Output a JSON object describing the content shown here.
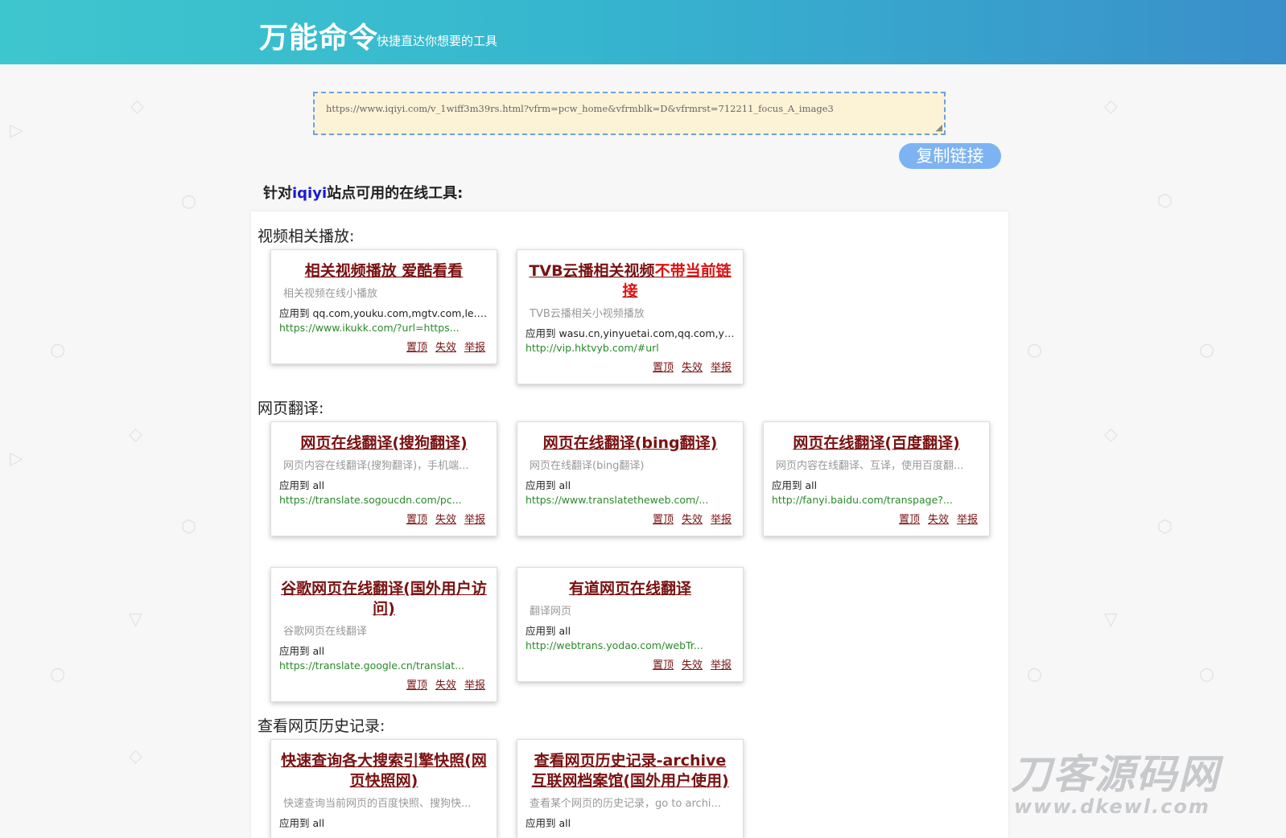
{
  "header": {
    "brand": "万能命令",
    "tagline": "快捷直达你想要的工具"
  },
  "url_box": {
    "value": "https://www.iqiyi.com/v_1wiff3m39rs.html?vfrm=pcw_home&vfrmblk=D&vfrmrst=712211_focus_A_image3"
  },
  "copy_button": {
    "label": "复制链接"
  },
  "site_heading": {
    "prefix": "针对",
    "site": "iqiyi",
    "suffix": "站点可用的在线工具:"
  },
  "sections": [
    {
      "title": "视频相关播放:",
      "cards": [
        {
          "title": "相关视频播放 爱酷看看",
          "desc": "相关视频在线小播放",
          "apply": "应用到 qq.com,youku.com,mgtv.com,le.com,...",
          "url": "https://www.ikukk.com/?url=https..."
        },
        {
          "title": "TVB云播相关视频",
          "title_warn": "不带当前链接",
          "desc": "TVB云播相关小视频播放",
          "apply": "应用到 wasu.cn,yinyuetai.com,qq.com,youku....",
          "url": "http://vip.hktvyb.com/#url"
        }
      ]
    },
    {
      "title": "网页翻译:",
      "cards": [
        {
          "title": "网页在线翻译(搜狗翻译)",
          "desc": "网页内容在线翻译(搜狗翻译)，手机端...",
          "apply": "应用到 all",
          "url": "https://translate.sogoucdn.com/pc..."
        },
        {
          "title": "网页在线翻译(bing翻译)",
          "desc": "网页在线翻译(bing翻译)",
          "apply": "应用到 all",
          "url": "https://www.translatetheweb.com/..."
        },
        {
          "title": "网页在线翻译(百度翻译)",
          "desc": "网页内容在线翻译、互译，使用百度翻...",
          "apply": "应用到 all",
          "url": "http://fanyi.baidu.com/transpage?..."
        },
        {
          "title": "谷歌网页在线翻译(国外用户访问)",
          "desc": "谷歌网页在线翻译",
          "apply": "应用到 all",
          "url": "https://translate.google.cn/translat..."
        },
        {
          "title": "有道网页在线翻译",
          "desc": "翻译网页",
          "apply": "应用到 all",
          "url": "http://webtrans.yodao.com/webTr..."
        }
      ]
    },
    {
      "title": "查看网页历史记录:",
      "cards": [
        {
          "title": "快速查询各大搜索引擎快照(网页快照网)",
          "desc": "快速查询当前网页的百度快照、搜狗快...",
          "apply": "应用到 all",
          "url": ""
        },
        {
          "title": "查看网页历史记录-archive互联网档案馆(国外用户使用)",
          "desc": "查看某个网页的历史记录，go to archi...",
          "apply": "应用到 all",
          "url": ""
        }
      ]
    }
  ],
  "card_actions": {
    "pin": "置顶",
    "invalid": "失效",
    "report": "举报"
  },
  "watermark": {
    "cn": "刀客源码网",
    "en": "www.dkewl.com"
  },
  "colors": {
    "header_start": "#3ec6ce",
    "header_end": "#3a8fca",
    "card_title": "#7a1212",
    "warn": "#e01010",
    "url_green": "#2a8a2a",
    "copy_button": "#7db3f2",
    "site_highlight": "#1a1ad6"
  }
}
